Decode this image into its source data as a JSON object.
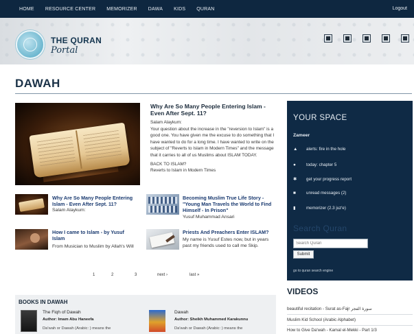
{
  "nav": {
    "items": [
      "HOME",
      "RESOURCE CENTER",
      "MEMORIZER",
      "DAWA",
      "KIDS",
      "QURAN"
    ],
    "logout": "Logout"
  },
  "header": {
    "logo_title": "THE QURAN",
    "logo_subtitle": "Portal",
    "toolbar_icons": [
      "toolbar-icon",
      "toolbar-icon",
      "toolbar-icon",
      "toolbar-icon",
      "toolbar-icon"
    ]
  },
  "page": {
    "title": "DAWAH"
  },
  "feature": {
    "title": "Why Are So Many People Entering Islam - Even After Sept. 11?",
    "greeting": "Salam Alaykum:",
    "body": "Your question about the increase in the \"reversion to Islam\" is a good one. You have given me the excuse to do something that I have wanted to do for a long time. I have wanted to write on the subject of \"Reverts to Islam in Modern Times\" and the message that it carries to all of us Muslims about ISLAM TODAY.",
    "back_line1": "BACK TO ISLAM?",
    "back_line2": "Reverts to Islam in Modern Times"
  },
  "articles": [
    {
      "title": "Why Are So Many People Entering Islam - Even After Sept. 11?",
      "body": "Salam Alaykum:"
    },
    {
      "title": "Becoming Muslim True Life Story - \"Young Man Travels the World to Find Himself - In Prison\"",
      "body": "Yusuf Muhammad Ansari"
    },
    {
      "title": "How I came to Islam - by Yusuf Islam",
      "body": "From Musician to Muslim by Allah's Will"
    },
    {
      "title": "Priests And Preachers Enter ISLAM?",
      "body": "My name is Yusuf Estes now, but in years past my friends used to call me Skip."
    }
  ],
  "pagination": {
    "pages": [
      "1",
      "2",
      "3"
    ],
    "next": "next ›",
    "last": "last »"
  },
  "books": {
    "title": "BOOKS IN DAWAH",
    "items": [
      {
        "title": "The Fiqh of Dawah",
        "author": "Author: Imam Abu Haneefa",
        "desc": "Da'wah or Dawah (Arabic: ) means the"
      },
      {
        "title": "Dawah",
        "author": "Author: Sheikh Muhammed Karakunnu",
        "desc": "Da'wah or Dawah (Arabic: ) means the"
      }
    ]
  },
  "your_space": {
    "title": "YOUR SPACE",
    "user": "Zameer",
    "items": [
      {
        "icon": "▲",
        "text": "alerts: fire in the hole"
      },
      {
        "icon": "●",
        "text": "today: chapter 5"
      },
      {
        "icon": "✱",
        "text": "get your progress report"
      },
      {
        "icon": "■",
        "text": "unread messages (2)"
      },
      {
        "icon": "▮",
        "text": "memorizer (2.3 juz'e)"
      }
    ]
  },
  "search": {
    "heading": "Search Quran",
    "placeholder": "Search Quran",
    "button": "Submit",
    "engine_link": "go to quran search engine"
  },
  "videos": {
    "title": "VIDEOS",
    "items": [
      "beautiful recitation - Surat as-Fajr سورة الفجر",
      "Muslim Kid School (Arabic Alphabet)",
      "How to Give Da'wah - Kamal el-Mekki - Part 1/3"
    ]
  },
  "colors": {
    "nav_bg": "#0e2740",
    "sidebar_bg": "#0f2a45",
    "link": "#1a3a70"
  }
}
